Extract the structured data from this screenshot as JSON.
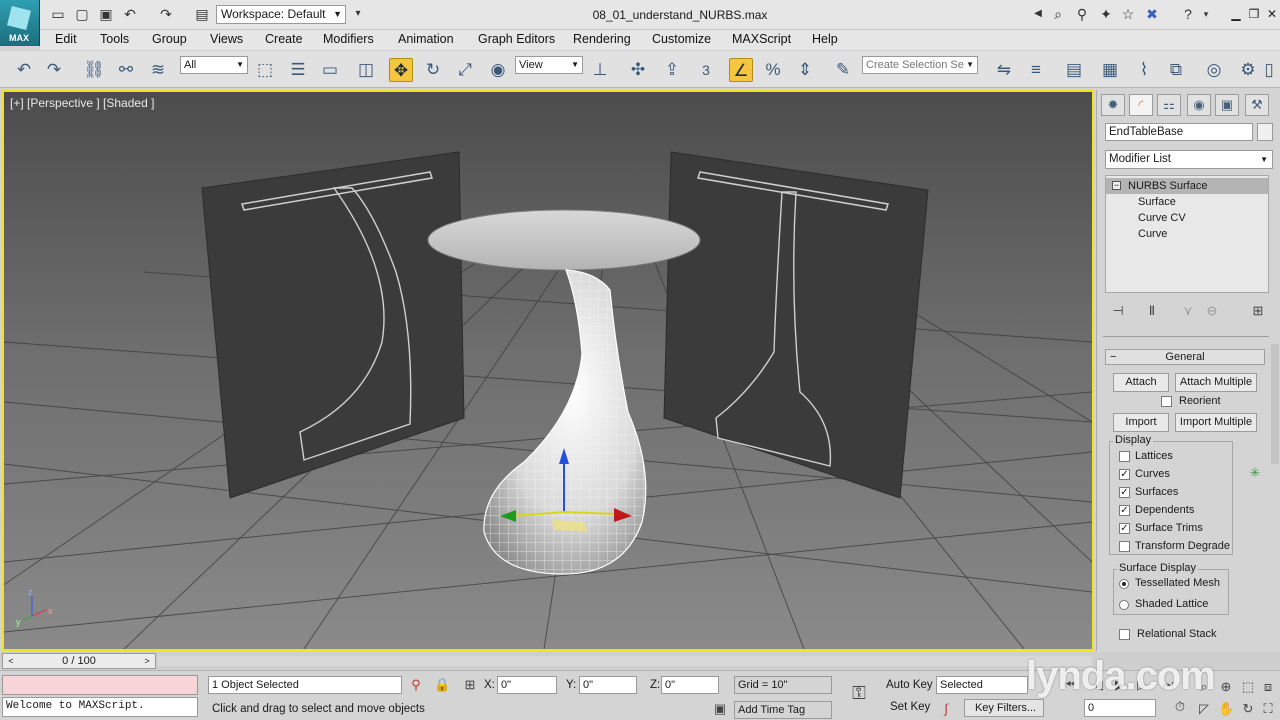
{
  "app": {
    "logo_text": "MAX",
    "workspace": "Workspace: Default",
    "document_title": "08_01_understand_NURBS.max"
  },
  "menu": [
    "Edit",
    "Tools",
    "Group",
    "Views",
    "Create",
    "Modifiers",
    "Animation",
    "Graph Editors",
    "Rendering",
    "Customize",
    "MAXScript",
    "Help"
  ],
  "toolbar": {
    "selection_filter": "All",
    "reference_coord": "View",
    "snap_number": "3",
    "named_selection_placeholder": "Create Selection Se"
  },
  "viewport": {
    "label": "[+] [Perspective ] [Shaded ]",
    "axis_labels": [
      "z",
      "x",
      "y"
    ]
  },
  "command_panel": {
    "object_name": "EndTableBase",
    "modifier_list": "Modifier List",
    "stack": {
      "root": "NURBS Surface",
      "items": [
        "Surface",
        "Curve CV",
        "Curve"
      ]
    },
    "general": {
      "title": "General",
      "attach": "Attach",
      "attach_multiple": "Attach Multiple",
      "reorient": "Reorient",
      "import": "Import",
      "import_multiple": "Import Multiple",
      "display_title": "Display",
      "display": [
        {
          "label": "Lattices",
          "checked": false
        },
        {
          "label": "Curves",
          "checked": true
        },
        {
          "label": "Surfaces",
          "checked": true
        },
        {
          "label": "Dependents",
          "checked": true
        },
        {
          "label": "Surface Trims",
          "checked": true
        },
        {
          "label": "Transform Degrade",
          "checked": false
        }
      ],
      "surface_display_title": "Surface Display",
      "surface_display": [
        {
          "label": "Tessellated Mesh",
          "selected": true
        },
        {
          "label": "Shaded Lattice",
          "selected": false
        }
      ],
      "relational_stack": "Relational Stack"
    }
  },
  "timeline": {
    "frame": "0 / 100"
  },
  "status": {
    "listener": "Welcome to MAXScript.",
    "selection": "1 Object Selected",
    "prompt": "Click and drag to select and move objects",
    "x_label": "X:",
    "x_value": "0\"",
    "y_label": "Y:",
    "y_value": "0\"",
    "z_label": "Z:",
    "z_value": "0\"",
    "grid": "Grid = 10\"",
    "add_time_tag": "Add Time Tag",
    "auto_key": "Auto Key",
    "set_key": "Set Key",
    "key_mode": "Selected",
    "key_filters": "Key Filters...",
    "current_frame": "0"
  },
  "watermark": "lynda.com",
  "colors": {
    "viewport_border": "#f2e31a",
    "active_tool": "#f5c640",
    "listener_bg": "#f6d4d8"
  }
}
